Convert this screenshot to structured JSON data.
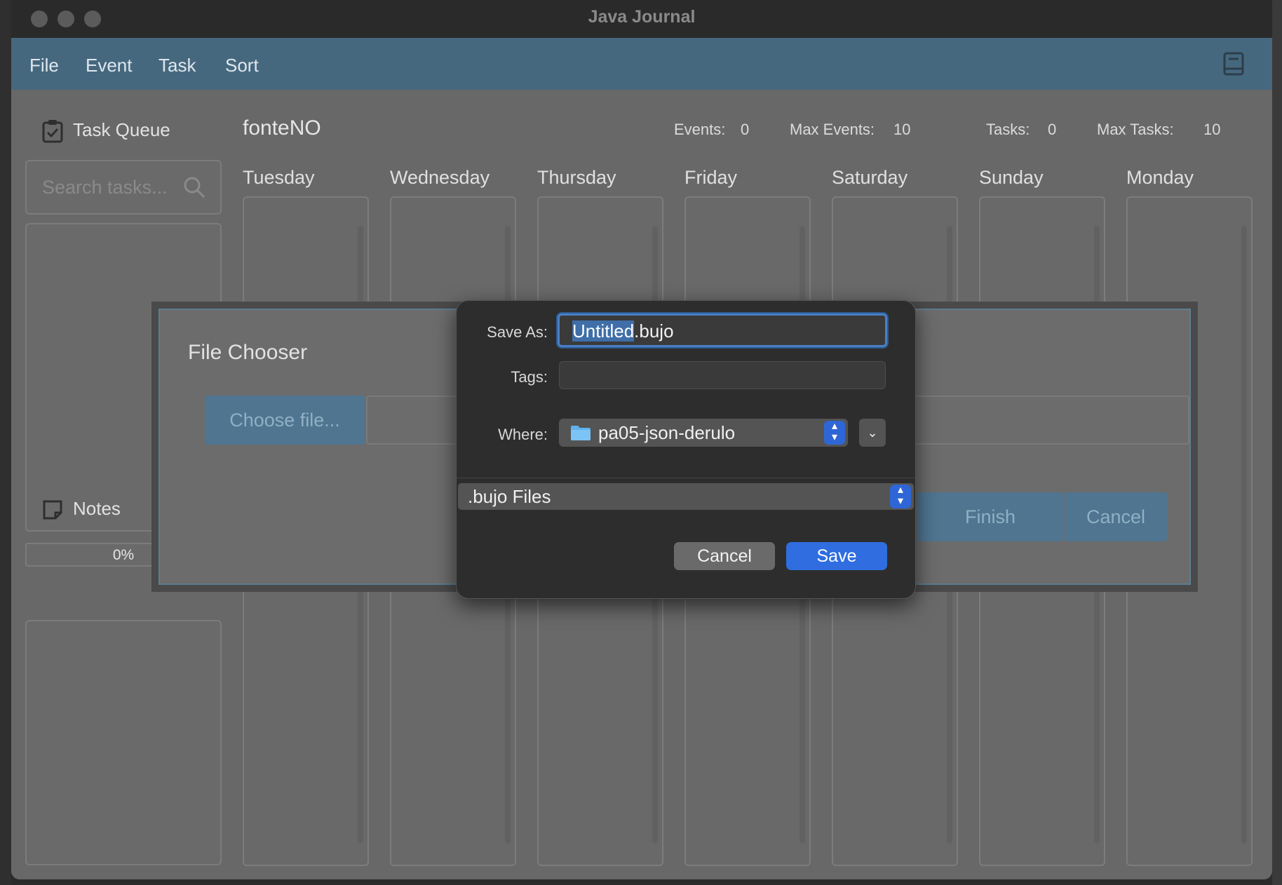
{
  "window": {
    "title": "Java Journal"
  },
  "menu": {
    "items": [
      "File",
      "Event",
      "Task",
      "Sort"
    ]
  },
  "sidebar": {
    "task_queue_title": "Task Queue",
    "search_placeholder": "Search tasks...",
    "progress": "0%",
    "notes_title": "Notes"
  },
  "journal": {
    "name": "fonteNO",
    "stats": {
      "events_label": "Events:",
      "events_value": "0",
      "max_events_label": "Max Events:",
      "max_events_value": "10",
      "tasks_label": "Tasks:",
      "tasks_value": "0",
      "max_tasks_label": "Max Tasks:",
      "max_tasks_value": "10"
    },
    "days": [
      "Tuesday",
      "Wednesday",
      "Thursday",
      "Friday",
      "Saturday",
      "Sunday",
      "Monday"
    ]
  },
  "file_chooser": {
    "title": "File Chooser",
    "choose_button": "Choose file...",
    "finish_button": "Finish",
    "cancel_button": "Cancel"
  },
  "save_dialog": {
    "save_as_label": "Save As:",
    "filename_selected": "Untitled",
    "filename_ext": ".bujo",
    "tags_label": "Tags:",
    "where_label": "Where:",
    "where_value": "pa05-json-derulo",
    "file_format": ".bujo Files",
    "cancel_button": "Cancel",
    "save_button": "Save"
  },
  "colors": {
    "accent": "#2f66d6",
    "menubar": "#46687f",
    "save_button": "#2f6de0"
  }
}
